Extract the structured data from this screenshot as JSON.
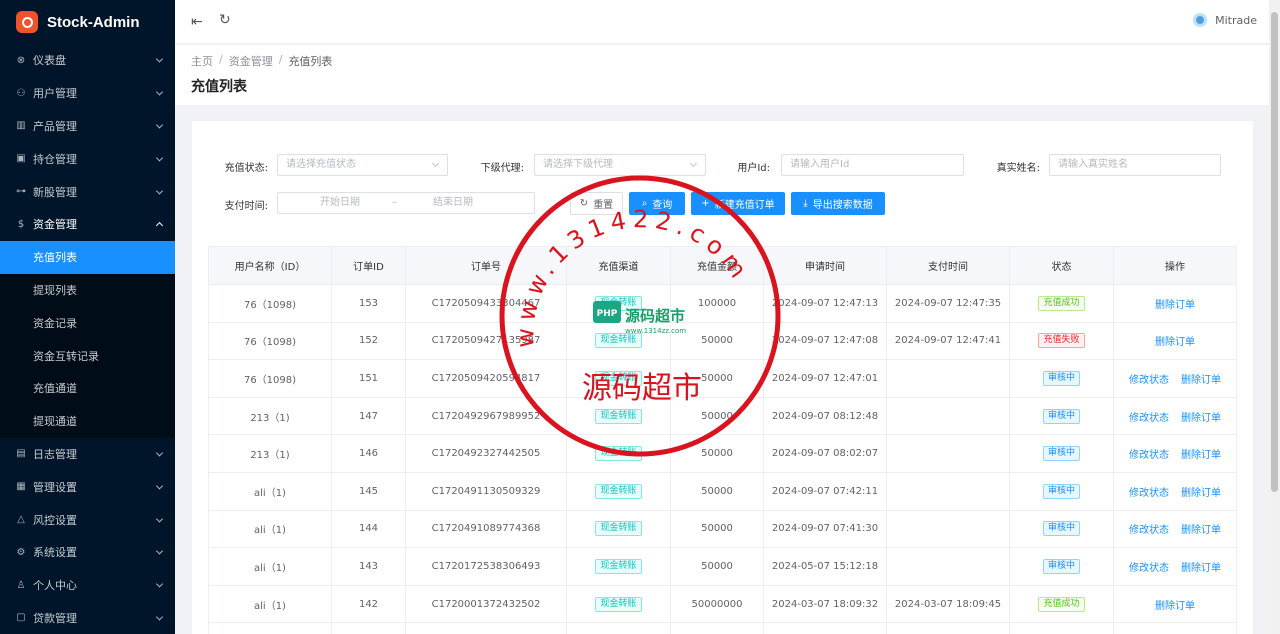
{
  "app": {
    "title": "Stock-Admin"
  },
  "sidebar": {
    "items": [
      {
        "label": "仪表盘",
        "icon": "dashboard-icon",
        "glyph": "⊗"
      },
      {
        "label": "用户管理",
        "icon": "users-icon",
        "glyph": "⚇"
      },
      {
        "label": "产品管理",
        "icon": "chart-icon",
        "glyph": "▥"
      },
      {
        "label": "持仓管理",
        "icon": "position-icon",
        "glyph": "▣"
      },
      {
        "label": "新股管理",
        "icon": "ipo-icon",
        "glyph": "⊶"
      },
      {
        "label": "资金管理",
        "icon": "money-icon",
        "glyph": "$",
        "open": true,
        "children": [
          "充值列表",
          "提现列表",
          "资金记录",
          "资金互转记录",
          "充值通道",
          "提现通道"
        ],
        "active_child": 0
      },
      {
        "label": "日志管理",
        "icon": "log-icon",
        "glyph": "▤"
      },
      {
        "label": "管理设置",
        "icon": "admin-settings-icon",
        "glyph": "▦"
      },
      {
        "label": "风控设置",
        "icon": "warning-icon",
        "glyph": "△"
      },
      {
        "label": "系统设置",
        "icon": "gear-icon",
        "glyph": "⚙"
      },
      {
        "label": "个人中心",
        "icon": "person-icon",
        "glyph": "♙"
      },
      {
        "label": "贷款管理",
        "icon": "loan-icon",
        "glyph": "▢"
      }
    ]
  },
  "header": {
    "user_name": "Mitrade"
  },
  "breadcrumb": [
    "主页",
    "资金管理",
    "充值列表"
  ],
  "page_title": "充值列表",
  "filters": {
    "status_label": "充值状态:",
    "status_placeholder": "请选择充值状态",
    "agent_label": "下级代理:",
    "agent_placeholder": "请选择下级代理",
    "userid_label": "用户Id:",
    "userid_placeholder": "请输入用户Id",
    "realname_label": "真实姓名:",
    "realname_placeholder": "请输入真实姓名",
    "paytime_label": "支付时间:",
    "start_date": "开始日期",
    "range_sep": "–",
    "end_date": "结束日期",
    "reset_label": "重置",
    "search_label": "查询",
    "create_label": "新建充值订单",
    "export_label": "导出搜索数据"
  },
  "table": {
    "columns": [
      "用户名称（ID）",
      "订单ID",
      "订单号",
      "充值渠道",
      "充值金额",
      "申请时间",
      "支付时间",
      "状态",
      "操作"
    ],
    "rows": [
      {
        "user": "76（1098)",
        "id": "153",
        "order_no": "C1720509433304467",
        "channel": "现金转账",
        "amount": "100000",
        "apply_time": "2024-09-07 12:47:13",
        "pay_time": "2024-09-07 12:47:35",
        "status": "充值成功",
        "status_type": "success",
        "actions": [
          "删除订单"
        ]
      },
      {
        "user": "76（1098)",
        "id": "152",
        "order_no": "C1720509427135987",
        "channel": "现金转账",
        "amount": "50000",
        "apply_time": "2024-09-07 12:47:08",
        "pay_time": "2024-09-07 12:47:41",
        "status": "充值失败",
        "status_type": "fail",
        "actions": [
          "删除订单"
        ]
      },
      {
        "user": "76（1098)",
        "id": "151",
        "order_no": "C1720509420594817",
        "channel": "现金转账",
        "amount": "50000",
        "apply_time": "2024-09-07 12:47:01",
        "pay_time": "",
        "status": "审核中",
        "status_type": "pending",
        "actions": [
          "修改状态",
          "删除订单"
        ]
      },
      {
        "user": "213（1)",
        "id": "147",
        "order_no": "C1720492967989952",
        "channel": "现金转账",
        "amount": "50000",
        "apply_time": "2024-09-07 08:12:48",
        "pay_time": "",
        "status": "审核中",
        "status_type": "pending",
        "actions": [
          "修改状态",
          "删除订单"
        ]
      },
      {
        "user": "213（1)",
        "id": "146",
        "order_no": "C1720492327442505",
        "channel": "现金转账",
        "amount": "50000",
        "apply_time": "2024-09-07 08:02:07",
        "pay_time": "",
        "status": "审核中",
        "status_type": "pending",
        "actions": [
          "修改状态",
          "删除订单"
        ]
      },
      {
        "user": "ali（1)",
        "id": "145",
        "order_no": "C1720491130509329",
        "channel": "现金转账",
        "amount": "50000",
        "apply_time": "2024-09-07 07:42:11",
        "pay_time": "",
        "status": "审核中",
        "status_type": "pending",
        "actions": [
          "修改状态",
          "删除订单"
        ]
      },
      {
        "user": "ali（1)",
        "id": "144",
        "order_no": "C1720491089774368",
        "channel": "现金转账",
        "amount": "50000",
        "apply_time": "2024-09-07 07:41:30",
        "pay_time": "",
        "status": "审核中",
        "status_type": "pending",
        "actions": [
          "修改状态",
          "删除订单"
        ]
      },
      {
        "user": "ali（1)",
        "id": "143",
        "order_no": "C1720172538306493",
        "channel": "现金转账",
        "amount": "50000",
        "apply_time": "2024-05-07 15:12:18",
        "pay_time": "",
        "status": "审核中",
        "status_type": "pending",
        "actions": [
          "修改状态",
          "删除订单"
        ]
      },
      {
        "user": "ali（1)",
        "id": "142",
        "order_no": "C1720001372432502",
        "channel": "现金转账",
        "amount": "50000000",
        "apply_time": "2024-03-07 18:09:32",
        "pay_time": "2024-03-07 18:09:45",
        "status": "充值成功",
        "status_type": "success",
        "actions": [
          "删除订单"
        ]
      },
      {
        "user": "",
        "id": "",
        "order_no": "",
        "channel": "",
        "amount": "",
        "apply_time": "",
        "pay_time": "",
        "status": "",
        "status_type": "",
        "actions": []
      }
    ]
  },
  "watermark": {
    "brand": "源码超市",
    "site": "www.1314zz.com",
    "stamp_text": "www.131422.com",
    "stamp_name": "源码超市",
    "color": "#d9141e"
  }
}
